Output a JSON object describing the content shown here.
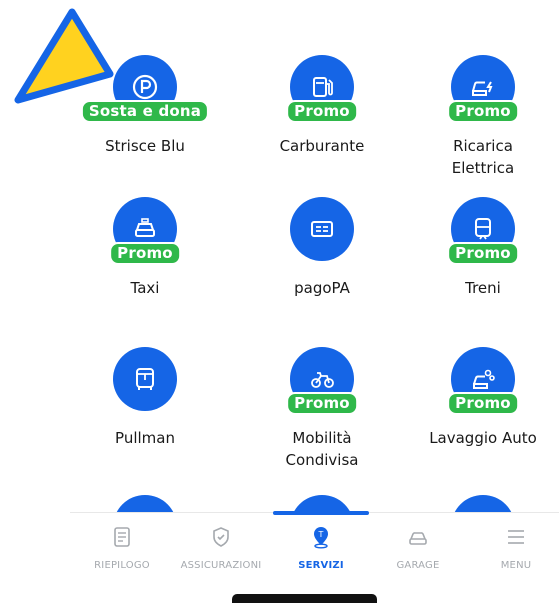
{
  "services": [
    {
      "id": "strisce-blu",
      "label": "Strisce Blu",
      "badge": "Sosta e dona",
      "icon": "parking-icon"
    },
    {
      "id": "carburante",
      "label": "Carburante",
      "badge": "Promo",
      "icon": "fuel-pump-icon"
    },
    {
      "id": "ricarica",
      "label": "Ricarica\nElettrica",
      "badge": "Promo",
      "icon": "ev-charging-icon"
    },
    {
      "id": "taxi",
      "label": "Taxi",
      "badge": "Promo",
      "icon": "taxi-icon"
    },
    {
      "id": "pagopa",
      "label": "pagoPA",
      "badge": "",
      "icon": "payment-card-icon"
    },
    {
      "id": "treni",
      "label": "Treni",
      "badge": "Promo",
      "icon": "train-icon"
    },
    {
      "id": "pullman",
      "label": "Pullman",
      "badge": "",
      "icon": "bus-icon"
    },
    {
      "id": "mobilita",
      "label": "Mobilità\nCondivisa",
      "badge": "Promo",
      "icon": "bike-sharing-icon"
    },
    {
      "id": "lavaggio",
      "label": "Lavaggio Auto",
      "badge": "Promo",
      "icon": "car-wash-icon"
    }
  ],
  "tabbar": {
    "riepilogo": "RIEPILOGO",
    "assicurazioni": "ASSICURAZIONI",
    "servizi": "SERVIZI",
    "garage": "GARAGE",
    "menu": "MENU"
  },
  "colors": {
    "accent": "#1565e6",
    "badge": "#2fb84a",
    "warning": "#ffd21f",
    "inactive": "#a5a9ae"
  }
}
